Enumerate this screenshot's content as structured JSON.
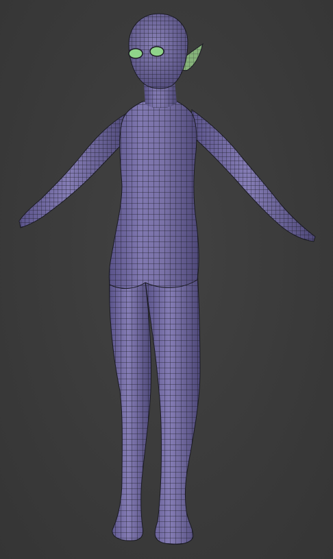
{
  "viewport": {
    "background_color": "#3b3b3b",
    "mode": "wireframe-on-shaded"
  },
  "model": {
    "description_icon": "humanoid-mesh",
    "body_color": "#7a72a8",
    "body_shadow_color": "#4e4878",
    "wire_color": "#1a1a22",
    "ear_color": "#86b37a",
    "eye_color": "#8fd48a",
    "pose": "A-pose"
  }
}
